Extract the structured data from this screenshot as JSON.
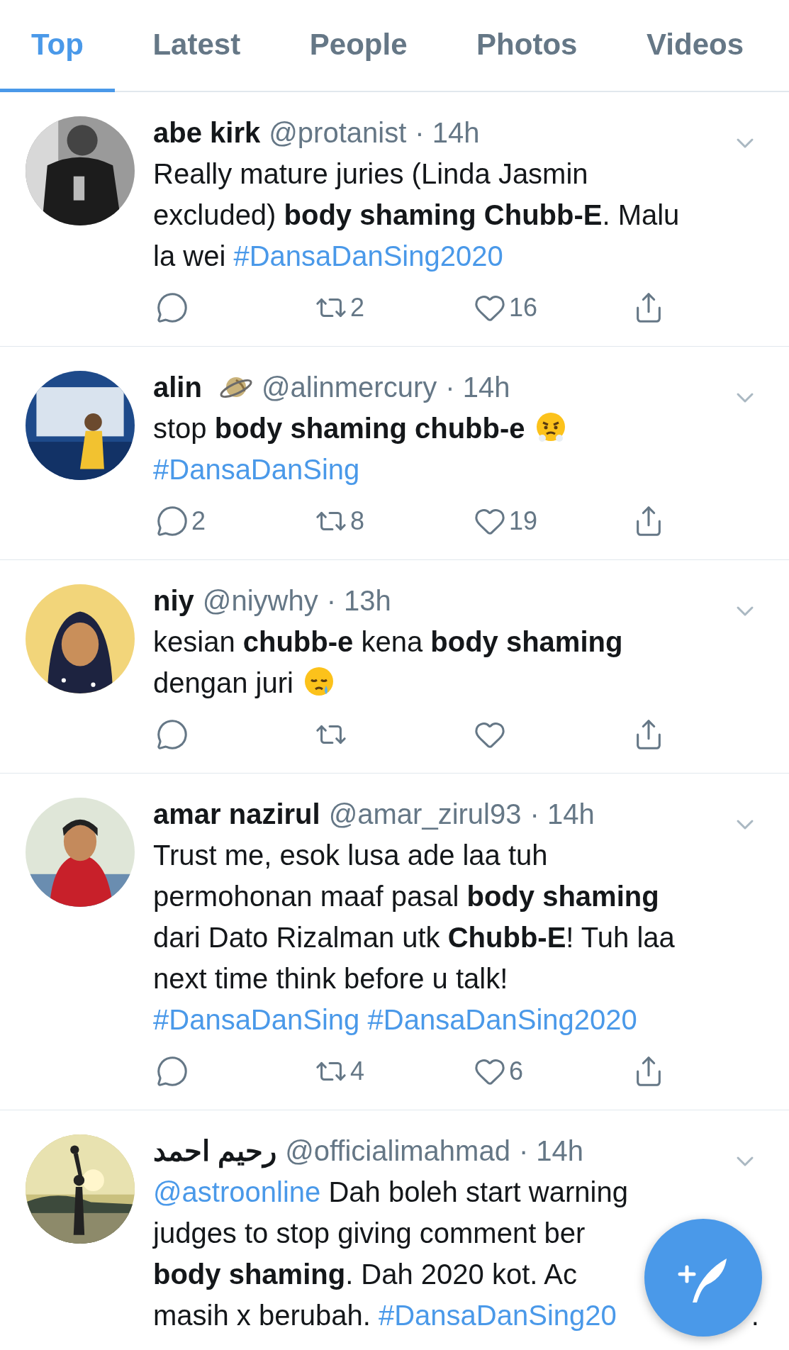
{
  "tabs": [
    {
      "label": "Top",
      "selected": true
    },
    {
      "label": "Latest",
      "selected": false
    },
    {
      "label": "People",
      "selected": false
    },
    {
      "label": "Photos",
      "selected": false
    },
    {
      "label": "Videos",
      "selected": false
    }
  ],
  "tweets": [
    {
      "name": "abe kirk",
      "handle": "@protanist",
      "time": "· 14h",
      "lines": [
        [
          {
            "kind": "text",
            "text": "Really mature juries (Linda Jasmin"
          }
        ],
        [
          {
            "kind": "text",
            "text": "excluded) "
          },
          {
            "kind": "bold",
            "text": "body shaming Chubb-E"
          },
          {
            "kind": "text",
            "text": ". Malu"
          }
        ],
        [
          {
            "kind": "text",
            "text": "la wei "
          },
          {
            "kind": "hashtag",
            "text": "#DansaDanSing2020"
          }
        ]
      ],
      "action_bar": true,
      "actions": {
        "retweets": "2",
        "likes": "16"
      }
    },
    {
      "name": "alin",
      "name_extra": [
        {
          "kind": "planet"
        }
      ],
      "handle": "@alinmercury",
      "time": "· 14h",
      "lines": [
        [
          {
            "kind": "text",
            "text": "stop "
          },
          {
            "kind": "bold",
            "text": "body shaming chubb-e"
          },
          {
            "kind": "huff_face"
          }
        ],
        [
          {
            "kind": "hashtag",
            "text": "#DansaDanSing"
          }
        ]
      ],
      "action_bar": true,
      "actions": {
        "replies": "2",
        "retweets": "8",
        "likes": "19"
      }
    },
    {
      "name": "niy",
      "handle": "@niywhy",
      "time": "· 13h",
      "lines": [
        [
          {
            "kind": "text",
            "text": "kesian "
          },
          {
            "kind": "bold",
            "text": "chubb-e"
          },
          {
            "kind": "text",
            "text": " kena "
          },
          {
            "kind": "bold",
            "text": "body shaming"
          }
        ],
        [
          {
            "kind": "text",
            "text": "dengan juri"
          },
          {
            "kind": "sleepy_face"
          }
        ]
      ],
      "action_bar": true
    },
    {
      "name": "amar nazirul",
      "handle": "@amar_zirul93",
      "time": "· 14h",
      "lines": [
        [
          {
            "kind": "text",
            "text": "Trust me, esok lusa ade laa tuh"
          }
        ],
        [
          {
            "kind": "text",
            "text": "permohonan maaf pasal "
          },
          {
            "kind": "bold",
            "text": "body shaming"
          }
        ],
        [
          {
            "kind": "text",
            "text": "dari Dato Rizalman utk "
          },
          {
            "kind": "bold",
            "text": "Chubb-E"
          },
          {
            "kind": "text",
            "text": "! Tuh laa"
          }
        ],
        [
          {
            "kind": "text",
            "text": "next time think before u talk!"
          }
        ],
        [
          {
            "kind": "hashtag",
            "text": "#DansaDanSing"
          },
          {
            "kind": "hashtag",
            "text": "#DansaDanSing2020"
          }
        ]
      ],
      "action_bar": true,
      "actions": {
        "retweets": "4",
        "likes": "6"
      }
    },
    {
      "name": "رحيم احمد",
      "handle": "@officialimahmad",
      "time": "· 14h",
      "lines": [
        [
          {
            "kind": "mention",
            "text": "@astroonline"
          },
          {
            "kind": "text",
            "text": " Dah boleh start warning"
          }
        ],
        [
          {
            "kind": "text",
            "text": "judges to stop giving comment ber"
          }
        ],
        [
          {
            "kind": "bold",
            "text": "body shaming"
          },
          {
            "kind": "text",
            "text": ". Dah 2020 kot.  Ac"
          }
        ],
        [
          {
            "kind": "text",
            "text": "masih x berubah.  "
          },
          {
            "kind": "hashtag",
            "text": "#DansaDanSing20"
          },
          {
            "kind": "tail",
            "text": "."
          }
        ]
      ]
    }
  ]
}
